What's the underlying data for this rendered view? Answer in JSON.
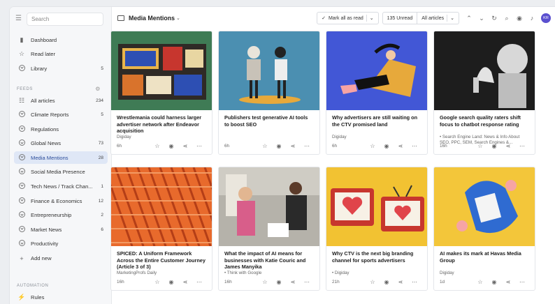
{
  "sidebar": {
    "search_placeholder": "Search",
    "top_items": [
      {
        "label": "Dashboard",
        "icon": "bar-chart-icon"
      },
      {
        "label": "Read later",
        "icon": "star-icon"
      },
      {
        "label": "Library",
        "count": "5",
        "icon": "chevron-circle-icon"
      }
    ],
    "feeds_label": "FEEDS",
    "feeds": [
      {
        "label": "All articles",
        "count": "234"
      },
      {
        "label": "Climate Reports",
        "count": "5"
      },
      {
        "label": "Regulations",
        "count": ""
      },
      {
        "label": "Global News",
        "count": "73"
      },
      {
        "label": "Media Mentions",
        "count": "28",
        "active": true
      },
      {
        "label": "Social Media Presence",
        "count": ""
      },
      {
        "label": "Tech News / Track Chan...",
        "count": "1"
      },
      {
        "label": "Finance & Economics",
        "count": "12"
      },
      {
        "label": "Entrepreneurship",
        "count": "2"
      },
      {
        "label": "Market News",
        "count": "6"
      },
      {
        "label": "Productivity",
        "count": ""
      },
      {
        "label": "Add new",
        "count": ""
      }
    ],
    "automation_label": "AUTOMATION",
    "rules_label": "Rules"
  },
  "header": {
    "title": "Media Mentions",
    "mark_all_read": "Mark all as read",
    "unread": "135 Unread",
    "filter": "All articles",
    "avatar": "KR"
  },
  "cards": [
    {
      "title": "Wrestlemania could harness larger advertiser network after Endeavor acquisition",
      "source": "Digiday",
      "age": "6h",
      "bg": "#3f7b55"
    },
    {
      "title": "Publishers test generative AI tools to boost SEO",
      "source": "",
      "age": "6h",
      "bg": "#4b8fb1"
    },
    {
      "title": "Why advertisers are still waiting on the CTV promised land",
      "source": "Digiday",
      "age": "6h",
      "bg": "#4257d6"
    },
    {
      "title": "Google search quality raters shift focus to chatbot response rating",
      "source": "• Search Engine Land: News & Info About SEO, PPC, SEM, Search Engines &...",
      "age": "16h",
      "bg": "#222222"
    },
    {
      "title": "SPICED: A Uniform Framework Across the Entire Customer Journey (Article 3 of 3)",
      "source": "MarketingProfs Daily",
      "age": "16h",
      "bg": "#e86a2c"
    },
    {
      "title": "What the impact of AI means for businesses with Katie Couric and James Manyika",
      "source": "• Think with Google",
      "age": "16h",
      "bg": "#8e8d88"
    },
    {
      "title": "Why CTV is the next big branding channel for sports advertisers",
      "source": "• Digiday",
      "age": "21h",
      "bg": "#f2c232"
    },
    {
      "title": "AI makes its mark at Havas Media Group",
      "source": "Digiday",
      "age": "1d",
      "bg": "#f3c63a"
    }
  ]
}
